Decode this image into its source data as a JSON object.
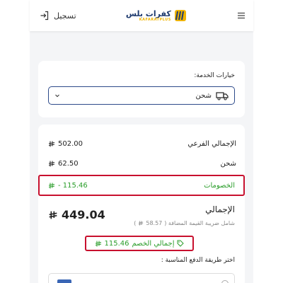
{
  "header": {
    "login_label": "تسجيل",
    "brand_name": "كفرات بلس",
    "brand_sub": "KAFARATPLUS",
    "login_icon": "login-icon",
    "menu_icon": "menu-icon"
  },
  "service": {
    "label": "خيارات الخدمة:",
    "selected": "شحن",
    "icon": "truck-icon"
  },
  "summary": {
    "subtotal_label": "الإجمالي الفرعي",
    "subtotal_value": "502.00",
    "shipping_label": "شحن",
    "shipping_value": "62.50",
    "discounts_label": "الخصومات",
    "discounts_value": "- 115.46",
    "total_label": "الإجمالي",
    "total_value": "449.04",
    "vat_prefix": "شامل ضريبة القيمة المضافة (",
    "vat_value": "58.57",
    "vat_suffix": ")",
    "discount_total_label": "إجمالي الخصم",
    "discount_total_value": "115.46"
  },
  "payment": {
    "label": "اختر طريقة الدفع المناسبة :"
  },
  "colors": {
    "accent": "#1e3a6e",
    "brand_yellow": "#f0b400",
    "discount_green": "#2a9d2a",
    "highlight_red": "#c8102e"
  }
}
